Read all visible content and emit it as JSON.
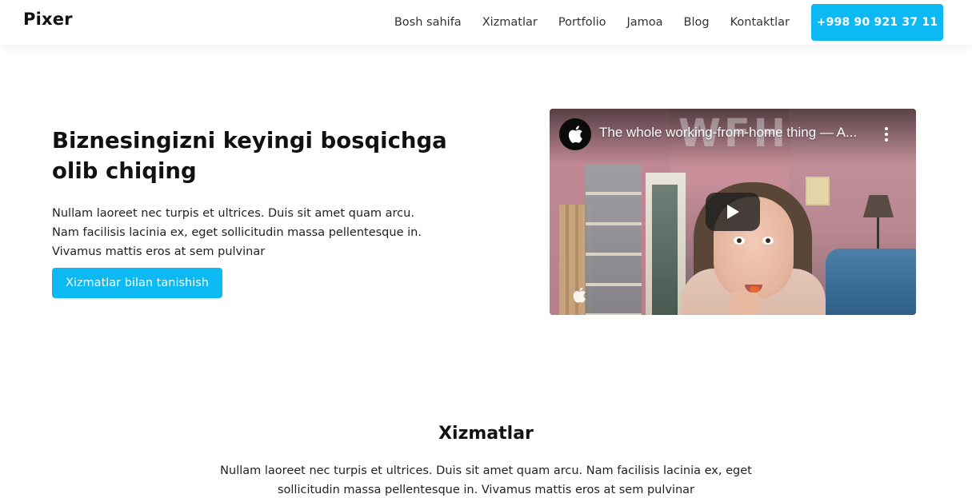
{
  "header": {
    "logo": "Pixer",
    "nav": [
      "Bosh sahifa",
      "Xizmatlar",
      "Portfolio",
      "Jamoa",
      "Blog",
      "Kontaktlar"
    ],
    "phone": "+998 90 921 37 11"
  },
  "hero": {
    "title": "Biznesingizni keyingi bosqichga olib chiqing",
    "text": "Nullam laoreet nec turpis et ultrices. Duis sit amet quam arcu. Nam facilisis lacinia ex, eget sollicitudin massa pellentesque in. Vivamus mattis eros at sem pulvinar",
    "button": "Xizmatlar bilan tanishish"
  },
  "video": {
    "title": "The whole working-from-home thing — A...",
    "watermark": "WFH",
    "channel_icon": "apple-logo-icon",
    "play_icon": "play-icon",
    "more_icon": "more-vertical-icon"
  },
  "services": {
    "title": "Xizmatlar",
    "text": "Nullam laoreet nec turpis et ultrices. Duis sit amet quam arcu. Nam facilisis lacinia ex, eget sollicitudin massa pellentesque in. Vivamus mattis eros at sem pulvinar"
  },
  "colors": {
    "accent": "#0db9f2"
  }
}
